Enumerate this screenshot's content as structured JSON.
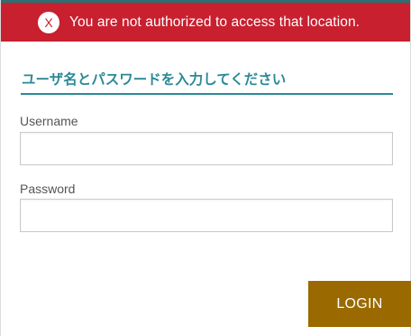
{
  "alert": {
    "icon": "close-icon",
    "icon_glyph": "X",
    "message": "You are not authorized to access that location.",
    "color": "#c8202f"
  },
  "form": {
    "heading": "ユーザ名とパスワードを入力してください",
    "username_label": "Username",
    "username_value": "",
    "password_label": "Password",
    "password_value": "",
    "login_label": "LOGIN"
  },
  "colors": {
    "accent": "#2b8a96",
    "button": "#9a6a00",
    "topline": "#2c6f73"
  }
}
